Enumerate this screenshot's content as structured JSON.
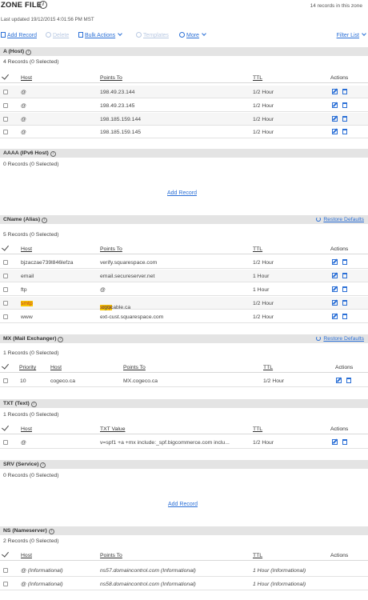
{
  "header": {
    "title": "ZONE FILE",
    "records_summary": "14 records in this zone",
    "last_updated": "Last updated 19/12/2015 4:01:56 PM MST"
  },
  "toolbar": {
    "add_record": "Add Record",
    "delete": "Delete",
    "bulk_actions": "Bulk Actions",
    "templates": "Templates",
    "more": "More",
    "filter_list": "Filter List"
  },
  "columns": {
    "host": "Host",
    "points_to": "Points To",
    "ttl": "TTL",
    "actions": "Actions",
    "priority": "Priority",
    "txt_value": "TXT Value"
  },
  "sections": {
    "a": {
      "title": "A (Host)",
      "count": "4 Records (0 Selected)",
      "rows": [
        {
          "host": "@",
          "points_to": "198.49.23.144",
          "ttl": "1/2 Hour"
        },
        {
          "host": "@",
          "points_to": "198.49.23.145",
          "ttl": "1/2 Hour"
        },
        {
          "host": "@",
          "points_to": "198.185.159.144",
          "ttl": "1/2 Hour"
        },
        {
          "host": "@",
          "points_to": "198.185.159.145",
          "ttl": "1/2 Hour"
        }
      ]
    },
    "aaaa": {
      "title": "AAAA (IPv6 Host)",
      "count": "0 Records (0 Selected)",
      "add_record": "Add Record"
    },
    "cname": {
      "title": "CName (Alias)",
      "count": "5 Records (0 Selected)",
      "restore": "Restore Defaults",
      "rows": [
        {
          "host": "bjzaczae739l846lefza",
          "points_to": "verify.squarespace.com",
          "ttl": "1/2 Hour"
        },
        {
          "host": "email",
          "points_to": "email.secureserver.net",
          "ttl": "1 Hour"
        },
        {
          "host": "ftp",
          "points_to": "@",
          "ttl": "1 Hour"
        },
        {
          "host": "smtp",
          "points_to_hl": "smtp",
          "points_to_rest": ".cgocable.ca",
          "ttl": "1/2 Hour"
        },
        {
          "host": "www",
          "points_to": "ext-cust.squarespace.com",
          "ttl": "1/2 Hour"
        }
      ]
    },
    "mx": {
      "title": "MX (Mail Exchanger)",
      "count": "1 Records (0 Selected)",
      "restore": "Restore Defaults",
      "rows": [
        {
          "priority": "10",
          "host": "cogeco.ca",
          "points_to": "MX.cogeco.ca",
          "ttl": "1/2 Hour"
        }
      ]
    },
    "txt": {
      "title": "TXT (Text)",
      "count": "1 Records (0 Selected)",
      "rows": [
        {
          "host": "@",
          "value": "v=spf1 +a +mx include:_spf.bigcommerce.com inclu...",
          "ttl": "1/2 Hour"
        }
      ]
    },
    "srv": {
      "title": "SRV (Service)",
      "count": "0 Records (0 Selected)",
      "add_record": "Add Record"
    },
    "ns": {
      "title": "NS (Nameserver)",
      "count": "2 Records (0 Selected)",
      "rows": [
        {
          "host": "@ (Informational)",
          "points_to": "ns57.domaincontrol.com (Informational)",
          "ttl": "1 Hour (Informational)"
        },
        {
          "host": "@ (Informational)",
          "points_to": "ns58.domaincontrol.com (Informational)",
          "ttl": "1 Hour (Informational)"
        }
      ]
    }
  },
  "colors": {
    "link": "#2a6fd6",
    "highlight": "#f7c500",
    "section_bg": "#e4e4e4"
  }
}
